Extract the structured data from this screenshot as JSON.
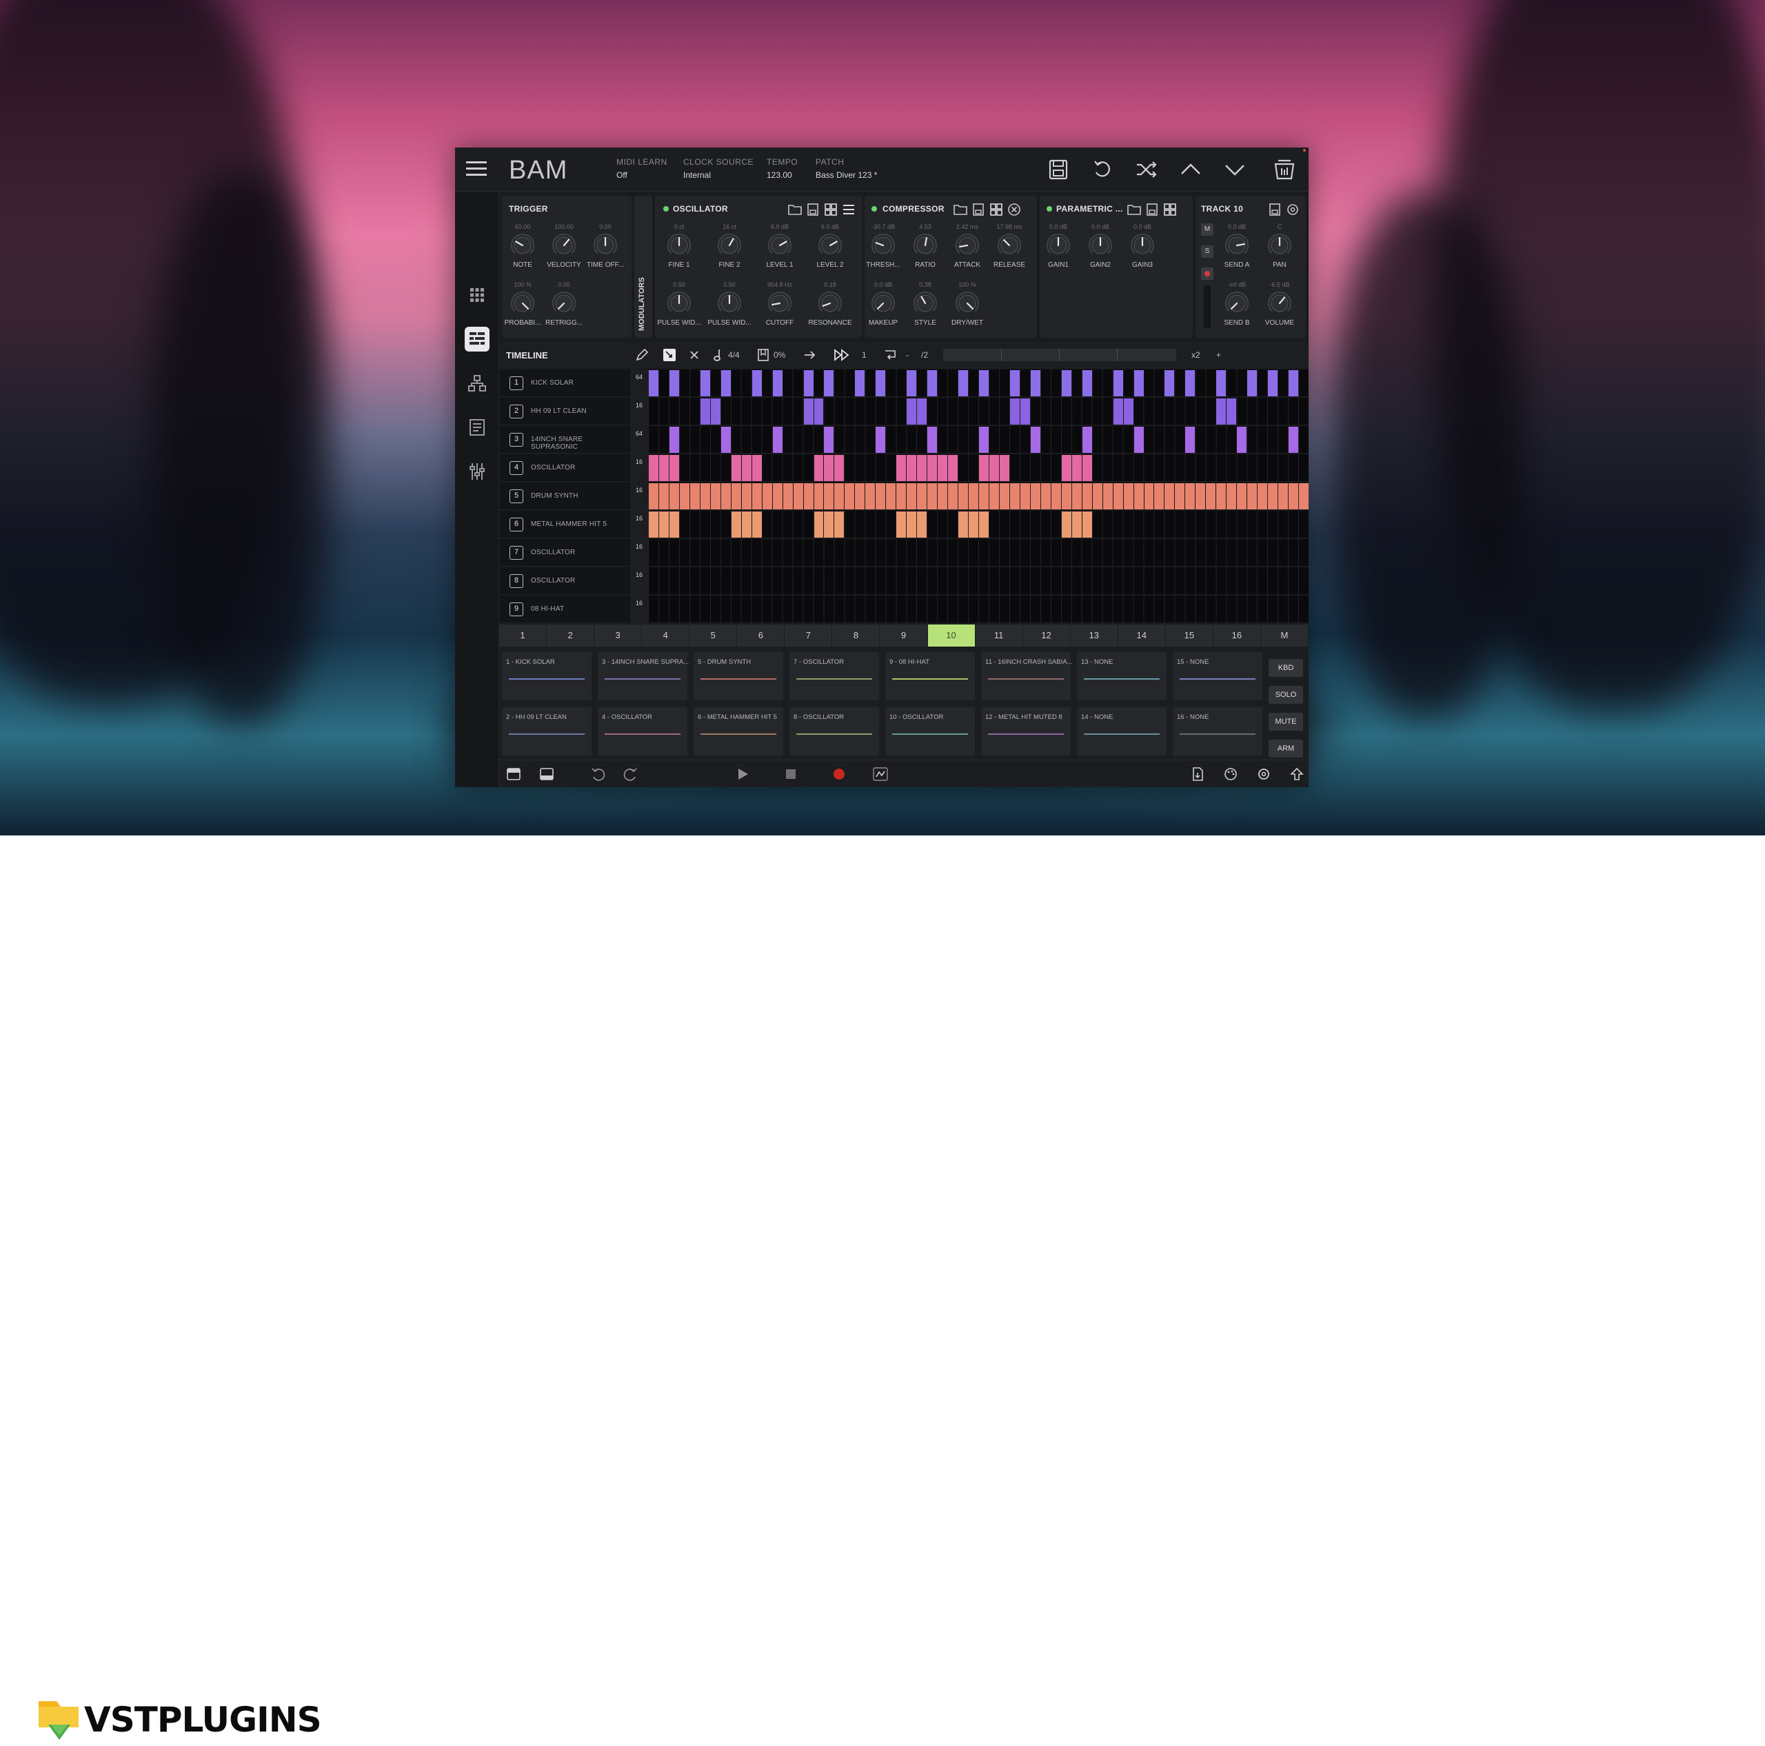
{
  "app": {
    "brand": "BAM",
    "header": [
      {
        "key": "MIDI LEARN",
        "value": "Off"
      },
      {
        "key": "CLOCK SOURCE",
        "value": "Internal"
      },
      {
        "key": "TEMPO",
        "value": "123.00"
      },
      {
        "key": "PATCH",
        "value": "Bass Diver 123 *"
      }
    ]
  },
  "panels": {
    "trigger": {
      "title": "TRIGGER",
      "knobs": [
        {
          "value": "60.00",
          "label": "NOTE"
        },
        {
          "value": "100.00",
          "label": "VELOCITY"
        },
        {
          "value": "0.00",
          "label": "TIME OFF..."
        },
        {
          "value": "100 %",
          "label": "PROBABI..."
        },
        {
          "value": "0.00",
          "label": "RETRIGG..."
        }
      ]
    },
    "modulators_label": "MODULATORS",
    "oscillator": {
      "title": "OSCILLATOR",
      "knobs": [
        {
          "value": "0 ct",
          "label": "FINE 1"
        },
        {
          "value": "16 ct",
          "label": "FINE 2"
        },
        {
          "value": "6.0 dB",
          "label": "LEVEL 1"
        },
        {
          "value": "6.0 dB",
          "label": "LEVEL 2"
        },
        {
          "value": "0.50",
          "label": "PULSE WID..."
        },
        {
          "value": "0.50",
          "label": "PULSE WID..."
        },
        {
          "value": "954.8 Hz",
          "label": "CUTOFF"
        },
        {
          "value": "0.18",
          "label": "RESONANCE"
        }
      ]
    },
    "compressor": {
      "title": "COMPRESSOR",
      "knobs": [
        {
          "value": "-30.7 dB",
          "label": "THRESH..."
        },
        {
          "value": "4.53",
          "label": "RATIO"
        },
        {
          "value": "2.42 ms",
          "label": "ATTACK"
        },
        {
          "value": "17.98 ms",
          "label": "RELEASE"
        },
        {
          "value": "0.0 dB",
          "label": "MAKEUP"
        },
        {
          "value": "0.38",
          "label": "STYLE"
        },
        {
          "value": "100 %",
          "label": "DRY/WET"
        }
      ]
    },
    "parametric": {
      "title": "PARAMETRIC ...",
      "knobs": [
        {
          "value": "0.0 dB",
          "label": "GAIN1"
        },
        {
          "value": "0.0 dB",
          "label": "GAIN2"
        },
        {
          "value": "0.0 dB",
          "label": "GAIN3"
        }
      ]
    },
    "track": {
      "title": "TRACK 10",
      "buttons": [
        "M",
        "S"
      ],
      "knobs": [
        {
          "value": "0.0 dB",
          "label": "SEND A"
        },
        {
          "value": "C",
          "label": "PAN"
        },
        {
          "value": "-inf dB",
          "label": "SEND B"
        },
        {
          "value": "-6.5 dB",
          "label": "VOLUME"
        }
      ]
    }
  },
  "timeline": {
    "title": "TIMELINE",
    "time_signature": "4/4",
    "swing": "0%",
    "division": "1",
    "loop_a": "-",
    "loop_b": "/2",
    "zoom": "x2",
    "zoom_plus": "+",
    "tracks": [
      {
        "num": "1",
        "name": "KICK SOLAR",
        "len": "64",
        "color": "#8c6fe8"
      },
      {
        "num": "2",
        "name": "HH 09 LT CLEAN",
        "len": "16",
        "color": "#8a63e0"
      },
      {
        "num": "3",
        "name": "14INCH SNARE SUPRASONIC",
        "len": "64",
        "color": "#a66ae6"
      },
      {
        "num": "4",
        "name": "OSCILLATOR",
        "len": "16",
        "color": "#e469a3"
      },
      {
        "num": "5",
        "name": "DRUM SYNTH",
        "len": "16",
        "color": "#e8846e"
      },
      {
        "num": "6",
        "name": "METAL HAMMER HIT 5",
        "len": "16",
        "color": "#eb9a72"
      },
      {
        "num": "7",
        "name": "OSCILLATOR",
        "len": "16",
        "color": "#000000"
      },
      {
        "num": "8",
        "name": "OSCILLATOR",
        "len": "16",
        "color": "#000000"
      },
      {
        "num": "9",
        "name": "08 HI-HAT",
        "len": "16",
        "color": "#000000"
      }
    ],
    "patterns": [
      [
        0,
        2,
        5,
        7,
        10,
        12,
        15,
        17,
        20,
        22,
        25,
        27,
        30,
        32,
        35,
        37,
        40,
        42,
        45,
        47,
        50,
        52,
        55,
        58,
        60,
        62
      ],
      [
        5,
        6,
        15,
        16,
        25,
        26,
        35,
        36,
        45,
        46,
        55,
        56
      ],
      [
        2,
        7,
        12,
        17,
        22,
        27,
        32,
        37,
        42,
        47,
        52,
        57,
        62
      ],
      [
        0,
        1,
        2,
        8,
        9,
        10,
        16,
        17,
        18,
        24,
        25,
        26,
        27,
        28,
        29,
        32,
        33,
        34,
        40,
        41,
        42
      ],
      [
        0,
        1,
        2,
        3,
        4,
        5,
        6,
        7,
        8,
        9,
        10,
        11,
        12,
        13,
        14,
        15,
        16,
        17,
        18,
        19,
        20,
        21,
        22,
        23,
        24,
        25,
        26,
        27,
        28,
        29,
        30,
        31,
        32,
        33,
        34,
        35,
        36,
        37,
        38,
        39,
        40,
        41,
        42,
        43,
        44,
        45,
        46,
        47,
        48,
        49,
        50,
        51,
        52,
        53,
        54,
        55,
        56,
        57,
        58,
        59,
        60,
        61,
        62,
        63
      ],
      [
        0,
        1,
        2,
        8,
        9,
        10,
        16,
        17,
        18,
        24,
        25,
        26,
        30,
        31,
        32,
        40,
        41,
        42
      ],
      [],
      [],
      []
    ]
  },
  "steps": {
    "labels": [
      "1",
      "2",
      "3",
      "4",
      "5",
      "6",
      "7",
      "8",
      "9",
      "10",
      "11",
      "12",
      "13",
      "14",
      "15",
      "16",
      "M"
    ],
    "active_index": 9,
    "active_color": "#b7e27a"
  },
  "pads": {
    "items": [
      "1 - KICK SOLAR",
      "3 - 14INCH SNARE SUPRA...",
      "5 - DRUM SYNTH",
      "7 - OSCILLATOR",
      "9 - 08 HI-HAT",
      "11 - 16INCH CRASH SABIA...",
      "13 - NONE",
      "15 - NONE",
      "2 - HH 09 LT CLEAN",
      "4 - OSCILLATOR",
      "6 - METAL HAMMER HIT 5",
      "8 - OSCILLATOR",
      "10 - OSCILLATOR",
      "12 - METAL HIT MUTED 8",
      "14 - NONE",
      "16 - NONE"
    ],
    "line_colors": [
      "#6d7fbf",
      "#7d6fa8",
      "#b96a6a",
      "#8e9a6a",
      "#b0c46a",
      "#8e6a6a",
      "#6a9aa8",
      "#7a7fbf",
      "#6a7aa0",
      "#a46a7a",
      "#a07a6a",
      "#8ea06a",
      "#6aa08e",
      "#8e6aa0",
      "#6a8ea0",
      "#6a6a7a"
    ],
    "side_buttons": [
      "KBD",
      "SOLO",
      "MUTE",
      "ARM"
    ]
  },
  "footer": {
    "logo_text": "VSTPLUGINS"
  }
}
